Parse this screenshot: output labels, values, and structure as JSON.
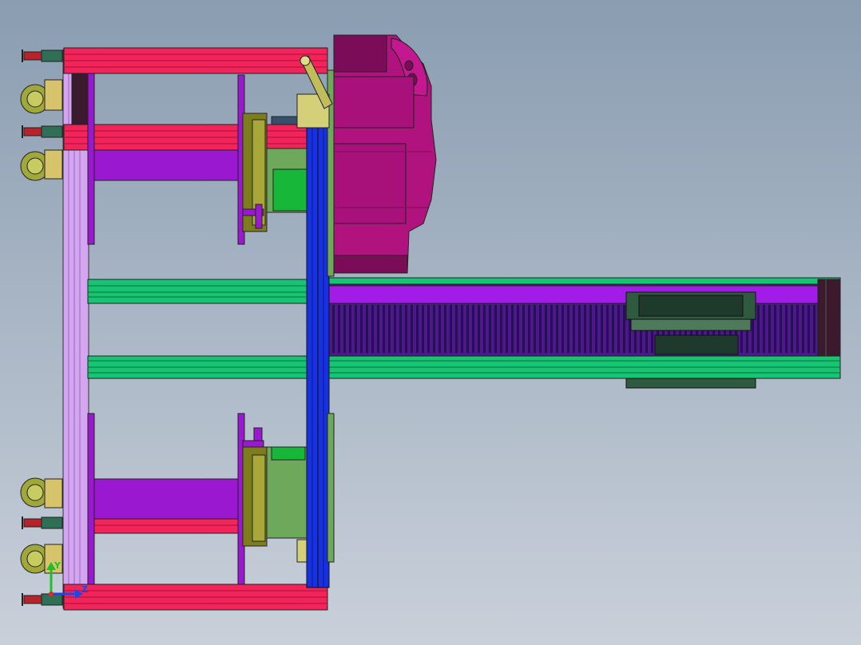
{
  "viewport": {
    "background_top": "#8a9db1",
    "background_bottom": "#c9d0da"
  },
  "colors": {
    "rail_red": "#f2245a",
    "rail_red_dark": "#a0143a",
    "rail_green": "#16c472",
    "rail_green_dark": "#0b6e3c",
    "column_blue": "#1730e0",
    "conveyor_purple": "#a21ce8",
    "conveyor_dark": "#4a1a86",
    "plate_violet": "#9a18d0",
    "frame_lavender": "#d3a6ef",
    "robot_magenta": "#b0127e",
    "robot_dark": "#7a0c58",
    "motor_green": "#17b83a",
    "motor_olive": "#6ea85a",
    "bracket_khaki": "#d4d07a",
    "caster_olive": "#9fa838",
    "caster_teal": "#2f6f55",
    "foot_red": "#b8222a",
    "flange_olive": "#7d7d1e",
    "carriage_dark": "#1e3a2c"
  },
  "triad": {
    "y_label": "Y",
    "z_label": "Z",
    "y_color": "#1fbf2a",
    "z_color": "#1d48e8",
    "x_color": "#e02828"
  }
}
